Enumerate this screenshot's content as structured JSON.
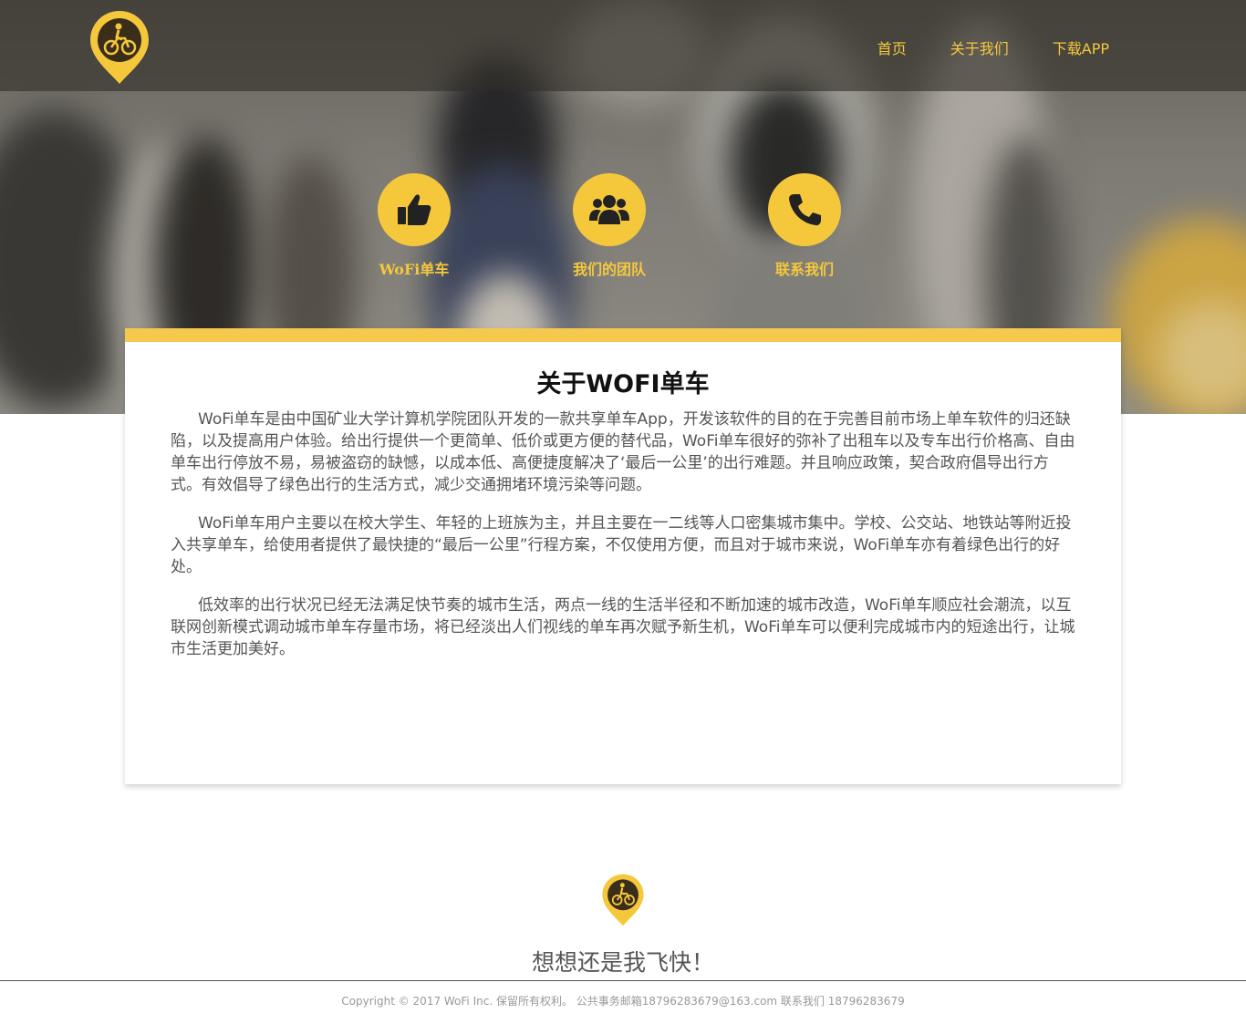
{
  "header": {
    "nav": [
      {
        "label": "首页"
      },
      {
        "label": "关于我们"
      },
      {
        "label": "下载APP"
      }
    ]
  },
  "features": [
    {
      "icon": "thumbs-up-icon",
      "label": "WoFi单车"
    },
    {
      "icon": "team-icon",
      "label": "我们的团队"
    },
    {
      "icon": "phone-icon",
      "label": "联系我们"
    }
  ],
  "about": {
    "title": "关于WOFI单车",
    "paragraphs": [
      "WoFi单车是由中国矿业大学计算机学院团队开发的一款共享单车App，开发该软件的目的在于完善目前市场上单车软件的归还缺陷，以及提高用户体验。给出行提供一个更简单、低价或更方便的替代品，WoFi单车很好的弥补了出租车以及专车出行价格高、自由单车出行停放不易，易被盗窃的缺憾，以成本低、高便捷度解决了‘最后一公里’的出行难题。并且响应政策，契合政府倡导出行方式。有效倡导了绿色出行的生活方式，减少交通拥堵环境污染等问题。",
      "WoFi单车用户主要以在校大学生、年轻的上班族为主，并且主要在一二线等人口密集城市集中。学校、公交站、地铁站等附近投入共享单车，给使用者提供了最快捷的“最后一公里”行程方案，不仅使用方便，而且对于城市来说，WoFi单车亦有着绿色出行的好处。",
      " 低效率的出行状况已经无法满足快节奏的城市生活，两点一线的生活半径和不断加速的城市改造，WoFi单车顺应社会潮流，以互联网创新模式调动城市单车存量市场，将已经淡出人们视线的单车再次赋予新生机，WoFi单车可以便利完成城市内的短途出行，让城市生活更加美好。"
    ]
  },
  "footer": {
    "slogan": "想想还是我飞快！",
    "copyright": "Copyright © 2017 WoFi Inc. 保留所有权利。 公共事务邮箱18796283679@163.com 联系我们 18796283679"
  },
  "colors": {
    "accent": "#f5c83c",
    "card_border": "#f5c94d",
    "logo_pin": "#f5c83c",
    "logo_inner": "#3a2e1a"
  }
}
